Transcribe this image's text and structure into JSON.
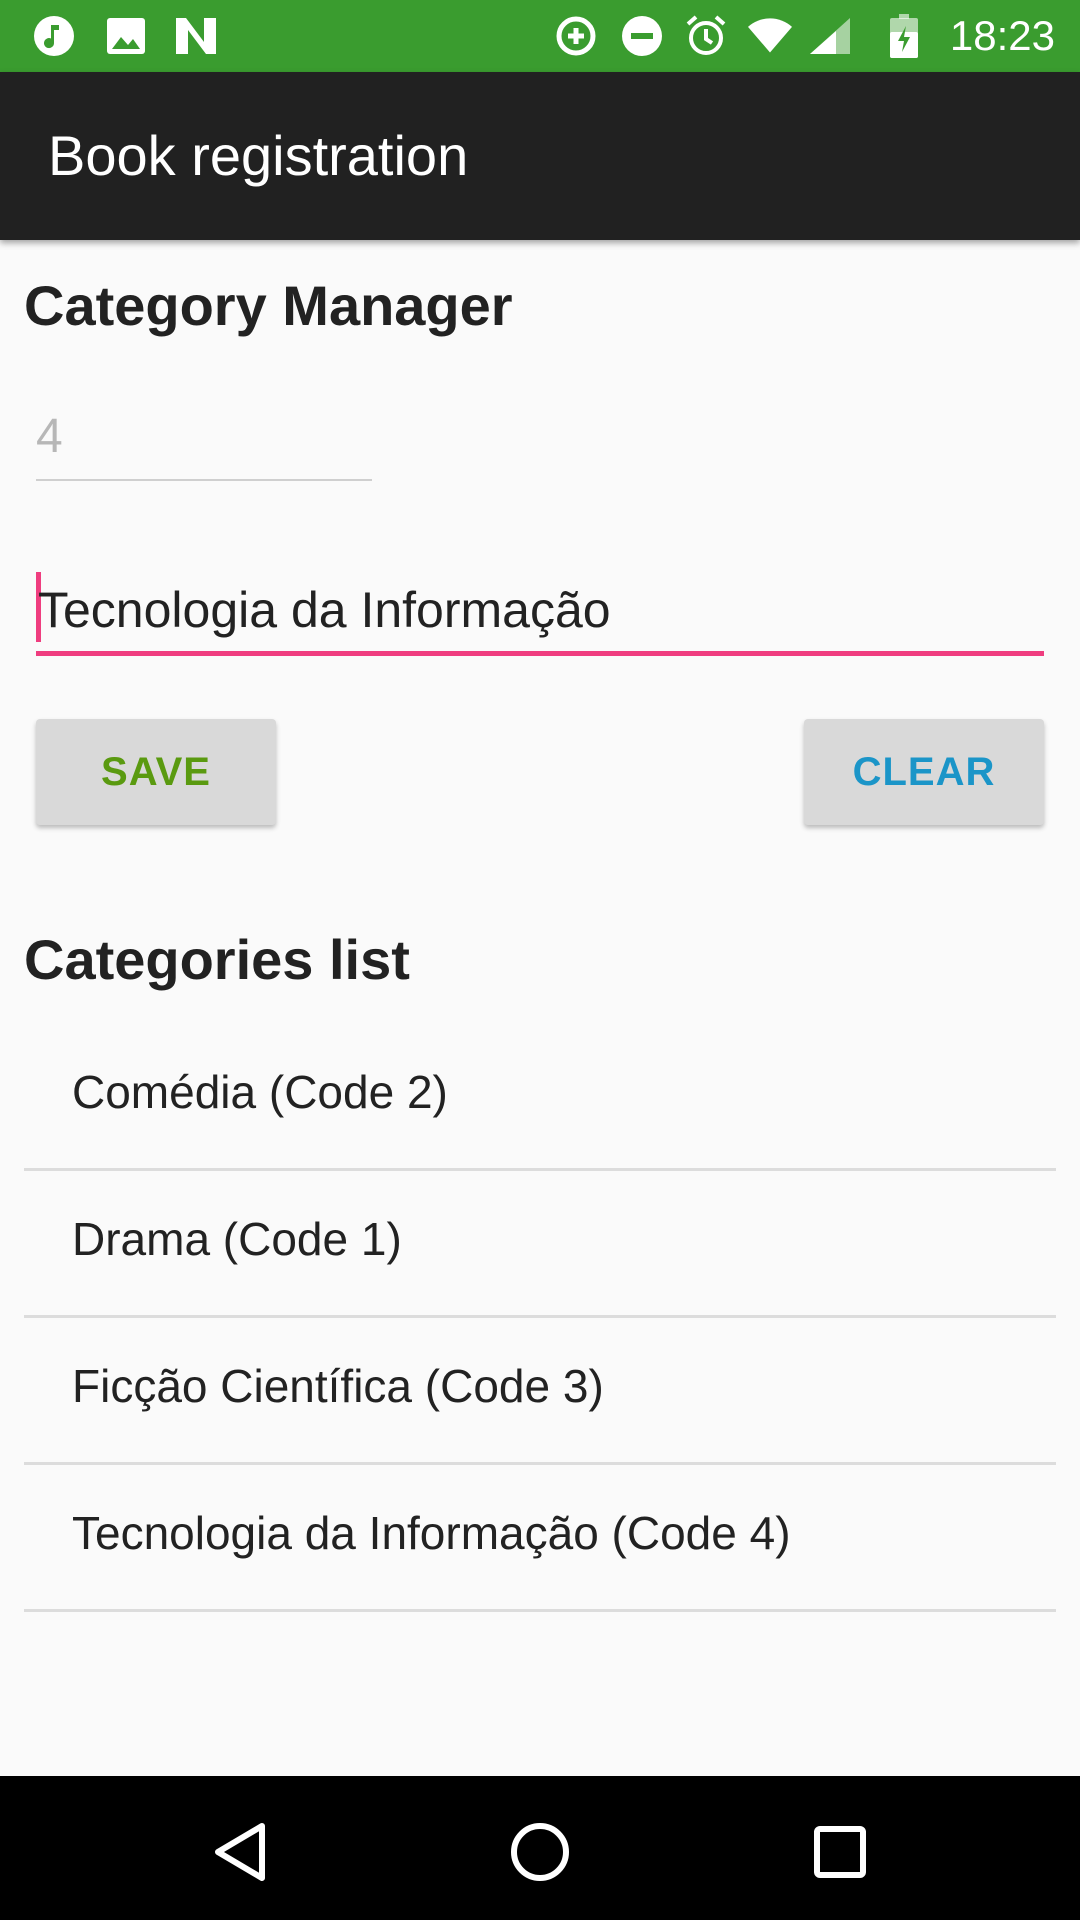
{
  "status_bar": {
    "time": "18:23",
    "icons": [
      "music-note-icon",
      "image-icon",
      "n-logo-icon",
      "data-saver-icon",
      "do-not-disturb-icon",
      "alarm-icon",
      "wifi-icon",
      "signal-icon",
      "battery-charging-icon"
    ],
    "color": "#3a9c2f"
  },
  "app_bar": {
    "title": "Book registration",
    "color": "#212121"
  },
  "manager": {
    "title": "Category Manager",
    "code_value": "4",
    "name_value": "Tecnologia da Informação",
    "accent_color": "#ef3d7f"
  },
  "buttons": {
    "save_label": "SAVE",
    "clear_label": "CLEAR",
    "save_color": "#5a9a10",
    "clear_color": "#1b95c8"
  },
  "list": {
    "title": "Categories list",
    "items": [
      {
        "label": "Comédia (Code 2)"
      },
      {
        "label": "Drama (Code 1)"
      },
      {
        "label": "Ficção Científica (Code 3)"
      },
      {
        "label": "Tecnologia da Informação (Code 4)"
      }
    ]
  },
  "nav_bar": {
    "icons": [
      "back-icon",
      "home-icon",
      "recents-icon"
    ]
  }
}
